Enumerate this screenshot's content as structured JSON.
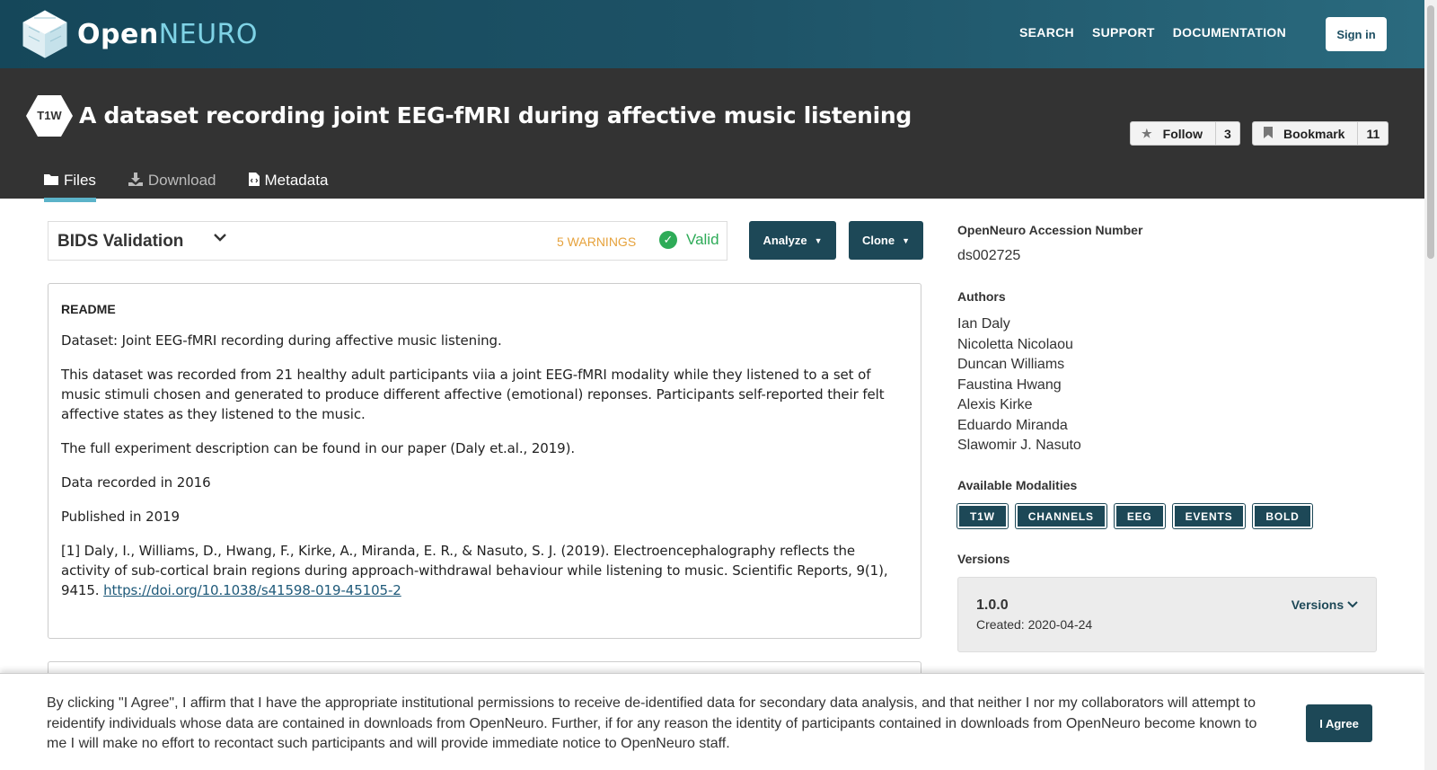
{
  "nav": {
    "logo_open": "Open",
    "logo_neuro": "NEURO",
    "links": [
      "SEARCH",
      "SUPPORT",
      "DOCUMENTATION"
    ],
    "signin_label": "Sign in"
  },
  "dataset": {
    "badge": "T1W",
    "title": "A dataset recording joint EEG-fMRI during affective music listening",
    "follow_label": "Follow",
    "follow_count": "3",
    "bookmark_label": "Bookmark",
    "bookmark_count": "11",
    "tabs": [
      "Files",
      "Download",
      "Metadata"
    ]
  },
  "validation": {
    "title": "BIDS Validation",
    "warnings": "5 WARNINGS",
    "status": "Valid"
  },
  "actions": {
    "analyze_label": "Analyze",
    "clone_label": "Clone"
  },
  "readme": {
    "heading": "README",
    "paragraphs": [
      "Dataset: Joint EEG-fMRI recording during affective music listening.",
      "This dataset was recorded from 21 healthy adult participants viia a joint EEG-fMRI modality while they listened to a set of music stimuli chosen and generated to produce different affective (emotional) reponses. Participants self-reported their felt affective states as they listened to the music.",
      "The full experiment description can be found in our paper (Daly et.al., 2019).",
      "Data recorded in 2016",
      "Published in 2019"
    ],
    "citation_text": "[1] Daly, I., Williams, D., Hwang, F., Kirke, A., Miranda, E. R., & Nasuto, S. J. (2019). Electroencephalography reflects the activity of sub-cortical brain regions during approach-withdrawal behaviour while listening to music. Scientific Reports, 9(1), 9415. ",
    "citation_link": "https://doi.org/10.1038/s41598-019-45105-2"
  },
  "sidebar": {
    "accession_label": "OpenNeuro Accession Number",
    "accession_value": "ds002725",
    "authors_label": "Authors",
    "authors": [
      "Ian Daly",
      "Nicoletta Nicolaou",
      "Duncan Williams",
      "Faustina Hwang",
      "Alexis Kirke",
      "Eduardo Miranda",
      "Slawomir J. Nasuto"
    ],
    "modalities_label": "Available Modalities",
    "modalities": [
      "T1W",
      "CHANNELS",
      "EEG",
      "EVENTS",
      "BOLD"
    ],
    "versions_label": "Versions",
    "version_number": "1.0.0",
    "version_created": "Created: 2020-04-24",
    "versions_select": "Versions"
  },
  "consent": {
    "text": "By clicking \"I Agree\", I affirm that I have the appropriate institutional permissions to receive de-identified data for secondary data analysis, and that neither I nor my collaborators will attempt to reidentify individuals whose data are contained in downloads from OpenNeuro. Further, if for any reason the identity of participants contained in downloads from OpenNeuro become known to me I will make no effort to recontact such participants and will provide immediate notice to OpenNeuro staff.",
    "agree_label": "I Agree"
  },
  "colors": {
    "brand_dark": "#1d4857",
    "header_bg": "#333333",
    "valid_green": "#2eab58",
    "warning_orange": "#e6a23c"
  }
}
